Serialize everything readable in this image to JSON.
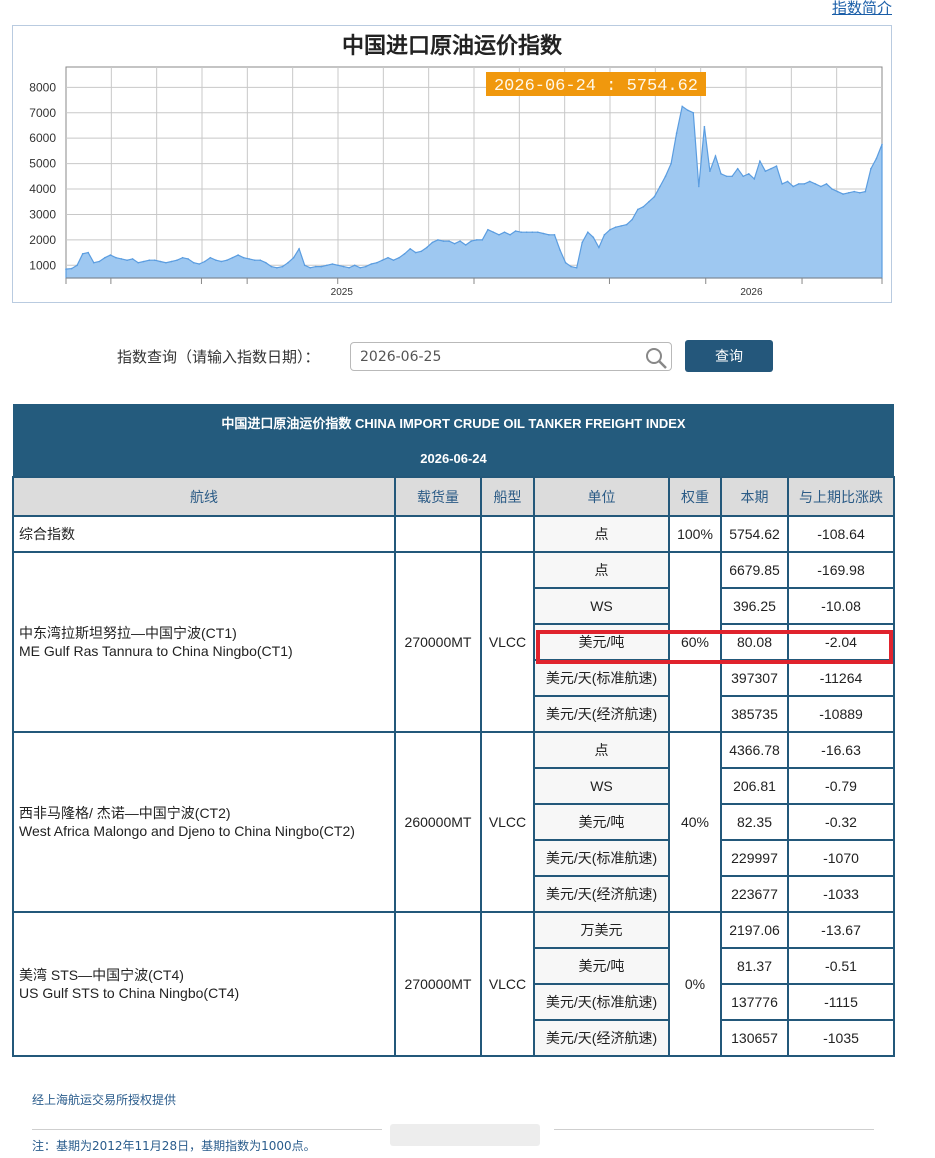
{
  "intro_link": "指数简介",
  "chart": {
    "title": "中国进口原油运价指数",
    "tooltip": "2026-06-24 : 5754.62",
    "y_ticks": [
      "8000",
      "7000",
      "6000",
      "5000",
      "4000",
      "3000",
      "2000",
      "1000"
    ],
    "x_ticks": [
      "2025",
      "2026"
    ]
  },
  "chart_data": {
    "type": "area",
    "title": "中国进口原油运价指数",
    "xlabel": "",
    "ylabel": "",
    "ylim": [
      500,
      8800
    ],
    "x_ticks": [
      "2025",
      "2026"
    ],
    "grid": true,
    "series": [
      {
        "values": [
          850,
          870,
          1000,
          1450,
          1500,
          1100,
          1150,
          1300,
          1400,
          1300,
          1250,
          1200,
          1250,
          1100,
          1150,
          1200,
          1200,
          1150,
          1100,
          1150,
          1200,
          1300,
          1250,
          1100,
          1050,
          1150,
          1300,
          1200,
          1150,
          1200,
          1300,
          1400,
          1300,
          1250,
          1200,
          1200,
          1100,
          950,
          900,
          950,
          1100,
          1300,
          1650,
          1000,
          900,
          950,
          950,
          1000,
          1050,
          1000,
          950,
          900,
          1000,
          900,
          950,
          1050,
          1100,
          1200,
          1300,
          1200,
          1300,
          1450,
          1650,
          1500,
          1550,
          1700,
          1900,
          2000,
          1950,
          1950,
          1850,
          1950,
          1800,
          1950,
          2000,
          2000,
          2400,
          2300,
          2200,
          2300,
          2200,
          2350,
          2300,
          2300,
          2300,
          2300,
          2250,
          2200,
          2200,
          1600,
          1100,
          950,
          900,
          1900,
          2300,
          2100,
          1700,
          2200,
          2400,
          2500,
          2550,
          2600,
          2800,
          3200,
          3300,
          3500,
          3700,
          4100,
          4500,
          5000,
          6200,
          7250,
          7100,
          7000,
          4100,
          6450,
          4700,
          5300,
          4600,
          4500,
          4500,
          4800,
          4500,
          4600,
          4400,
          5100,
          4700,
          4800,
          4900,
          4200,
          4300,
          4100,
          4200,
          4200,
          4300,
          4200,
          4100,
          4200,
          4000,
          3900,
          3800,
          3850,
          3900,
          3850,
          3900,
          4800,
          5200,
          5754.62
        ]
      }
    ],
    "latest": {
      "date": "2026-06-24",
      "value": 5754.62
    }
  },
  "query": {
    "label": "指数查询（请输入指数日期）：",
    "input_value": "2026-06-25",
    "button": "查询"
  },
  "table": {
    "title": "中国进口原油运价指数 CHINA IMPORT CRUDE OIL TANKER FREIGHT INDEX",
    "date": "2026-06-24",
    "headers": [
      "航线",
      "载货量",
      "船型",
      "单位",
      "权重",
      "本期",
      "与上期比涨跌"
    ],
    "composite": {
      "name": "综合指数",
      "unit": "点",
      "weight": "100%",
      "current": "5754.62",
      "change": "-108.64"
    },
    "routes": [
      {
        "name_cn": "中东湾拉斯坦努拉—中国宁波(CT1)",
        "name_en": "ME Gulf Ras Tannura to China Ningbo(CT1)",
        "capacity": "270000MT",
        "ship_type": "VLCC",
        "weight": "60%",
        "rows": [
          {
            "unit": "点",
            "current": "6679.85",
            "change": "-169.98"
          },
          {
            "unit": "WS",
            "current": "396.25",
            "change": "-10.08"
          },
          {
            "unit": "美元/吨",
            "current": "80.08",
            "change": "-2.04"
          },
          {
            "unit": "美元/天(标准航速)",
            "current": "397307",
            "change": "-11264"
          },
          {
            "unit": "美元/天(经济航速)",
            "current": "385735",
            "change": "-10889"
          }
        ]
      },
      {
        "name_cn": "西非马隆格/ 杰诺—中国宁波(CT2)",
        "name_en": "West Africa Malongo and Djeno to China Ningbo(CT2)",
        "capacity": "260000MT",
        "ship_type": "VLCC",
        "weight": "40%",
        "rows": [
          {
            "unit": "点",
            "current": "4366.78",
            "change": "-16.63"
          },
          {
            "unit": "WS",
            "current": "206.81",
            "change": "-0.79"
          },
          {
            "unit": "美元/吨",
            "current": "82.35",
            "change": "-0.32"
          },
          {
            "unit": "美元/天(标准航速)",
            "current": "229997",
            "change": "-1070"
          },
          {
            "unit": "美元/天(经济航速)",
            "current": "223677",
            "change": "-1033"
          }
        ]
      },
      {
        "name_cn": "美湾 STS—中国宁波(CT4)",
        "name_en": "US Gulf STS to China Ningbo(CT4)",
        "capacity": "270000MT",
        "ship_type": "VLCC",
        "weight": "0%",
        "rows": [
          {
            "unit": "万美元",
            "current": "2197.06",
            "change": "-13.67"
          },
          {
            "unit": "美元/吨",
            "current": "81.37",
            "change": "-0.51"
          },
          {
            "unit": "美元/天(标准航速)",
            "current": "137776",
            "change": "-1115"
          },
          {
            "unit": "美元/天(经济航速)",
            "current": "130657",
            "change": "-1035"
          }
        ]
      }
    ]
  },
  "footer": {
    "source": "经上海航运交易所授权提供",
    "note": "注：基期为2012年11月28日，基期指数为1000点。"
  },
  "colors": {
    "accent": "#245b7d",
    "highlight": "#e0232d",
    "area_fill": "#9ec8f1",
    "area_line": "#5b9de0",
    "tooltip_bg": "#f0980d"
  }
}
